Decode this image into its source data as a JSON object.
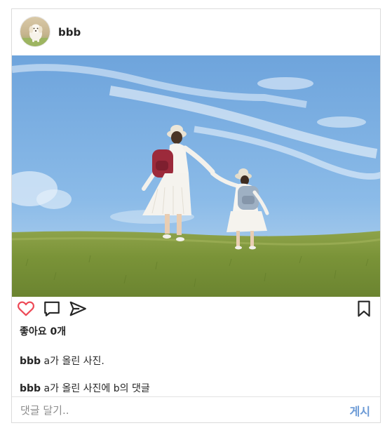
{
  "post": {
    "author": "bbb",
    "likes_text": "좋아요 0개",
    "caption": {
      "user": "bbb",
      "text": "a가 올린 사진."
    },
    "comments": [
      {
        "user": "bbb",
        "text": "a가 올린 사진에 b의 댓글"
      }
    ]
  },
  "comment_box": {
    "placeholder": "댓글 달기..",
    "submit_label": "게시"
  },
  "icons": {
    "like": "heart-icon",
    "comment": "comment-icon",
    "share": "send-icon",
    "save": "bookmark-icon"
  },
  "colors": {
    "like_icon": "#ed4956",
    "post_button": "#6b9ad6",
    "border": "#dbdbdb"
  }
}
